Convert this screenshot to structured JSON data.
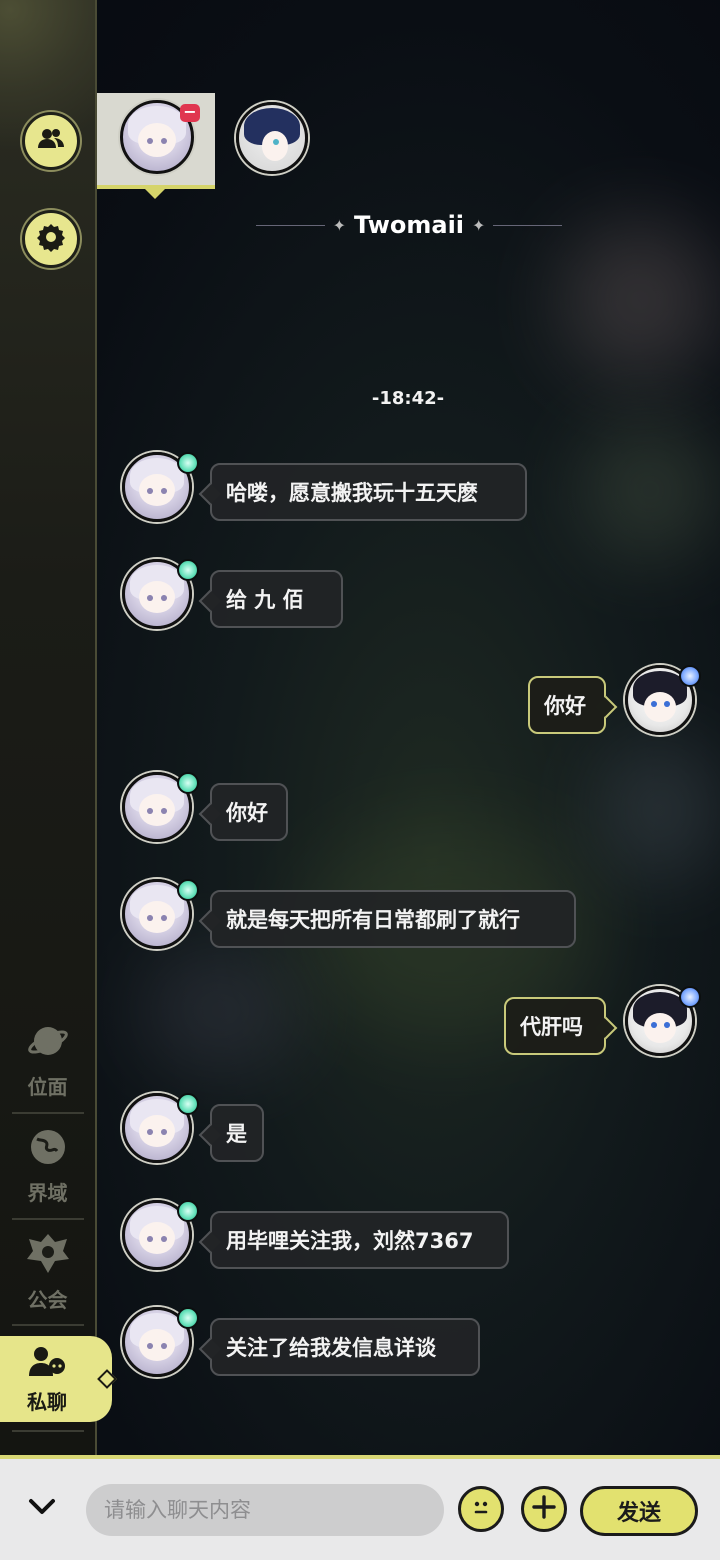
{
  "sidebar": {
    "items": [
      {
        "label": "位面",
        "icon": "planet-icon"
      },
      {
        "label": "界域",
        "icon": "globe-icon"
      },
      {
        "label": "公会",
        "icon": "guild-crest-icon"
      },
      {
        "label": "私聊",
        "icon": "private-chat-icon",
        "active": true
      }
    ],
    "top_buttons": [
      {
        "icon": "friends-icon"
      },
      {
        "icon": "gear-icon"
      }
    ]
  },
  "conversations": {
    "selected_badge": "−"
  },
  "chat": {
    "title": "Twomaii",
    "timestamp": "-18:42-",
    "messages": [
      {
        "side": "left",
        "text": "哈喽，愿意搬我玩十五天麽"
      },
      {
        "side": "left",
        "text": "给 九 佰"
      },
      {
        "side": "right",
        "text": "你好"
      },
      {
        "side": "left",
        "text": "你好"
      },
      {
        "side": "left",
        "text": "就是每天把所有日常都刷了就行"
      },
      {
        "side": "right",
        "text": "代肝吗"
      },
      {
        "side": "left",
        "text": "是"
      },
      {
        "side": "left",
        "text": "用毕哩关注我，刘然7367"
      },
      {
        "side": "left",
        "text": "关注了给我发信息详谈"
      }
    ]
  },
  "input": {
    "placeholder": "请输入聊天内容",
    "send_label": "发送"
  },
  "colors": {
    "accent": "#e2e16f",
    "sidebar_bg": "#1b1c17",
    "bubble_bg": "#222426",
    "badge_red": "#e0364f"
  }
}
